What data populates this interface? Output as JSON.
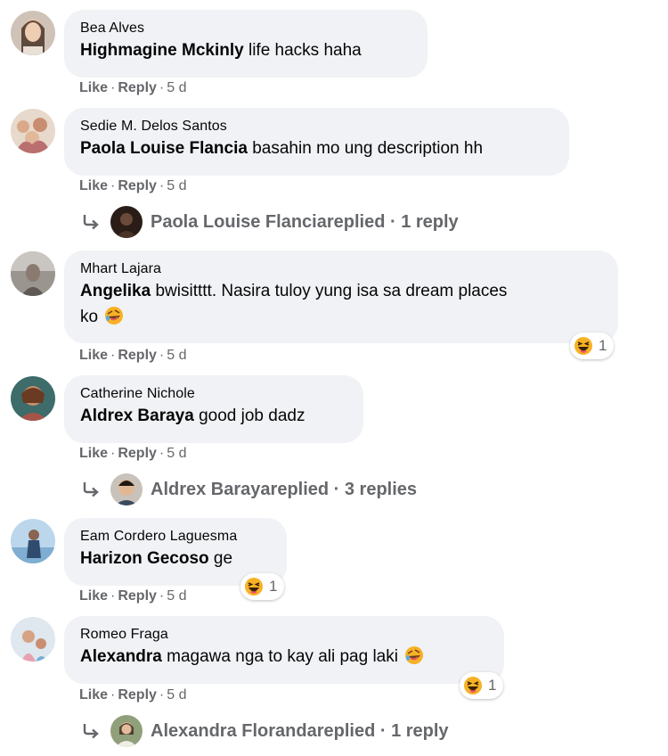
{
  "actions": {
    "like": "Like",
    "reply": "Reply",
    "separator": "·"
  },
  "comments": [
    {
      "author": "Bea Alves",
      "mention": "Highmagine Mckinly",
      "text": " life hacks haha",
      "time": "5 d"
    },
    {
      "author": "Sedie M. Delos Santos",
      "mention": "Paola Louise Flancia",
      "text": " basahin mo ung description hh",
      "time": "5 d",
      "replies": {
        "name": "Paola Louise Flancia",
        "summary": " replied · 1 reply"
      }
    },
    {
      "author": "Mhart Lajara",
      "mention": "Angelika",
      "text": " bwisitttt. Nasira tuloy yung isa sa dream places",
      "text2": "ko",
      "time": "5 d",
      "reaction": {
        "icon": "haha-icon",
        "count": "1"
      }
    },
    {
      "author": "Catherine Nichole",
      "mention": "Aldrex Baraya",
      "text": " good job dadz",
      "time": "5 d",
      "replies": {
        "name": "Aldrex Baraya",
        "summary": " replied · 3 replies"
      }
    },
    {
      "author": "Eam Cordero Laguesma",
      "mention": "Harizon Gecoso",
      "text": " ge",
      "time": "5 d",
      "reaction": {
        "icon": "haha-icon",
        "count": "1"
      }
    },
    {
      "author": "Romeo Fraga",
      "mention": "Alexandra",
      "text": " magawa nga to kay ali pag laki",
      "time": "5 d",
      "reaction": {
        "icon": "haha-icon",
        "count": "1"
      },
      "replies": {
        "name": "Alexandra Floranda",
        "summary": " replied · 1 reply"
      }
    }
  ],
  "colors": {
    "bubble": "#f0f2f5",
    "muted": "#65676b",
    "text": "#050505",
    "haha": "#f7b125"
  }
}
